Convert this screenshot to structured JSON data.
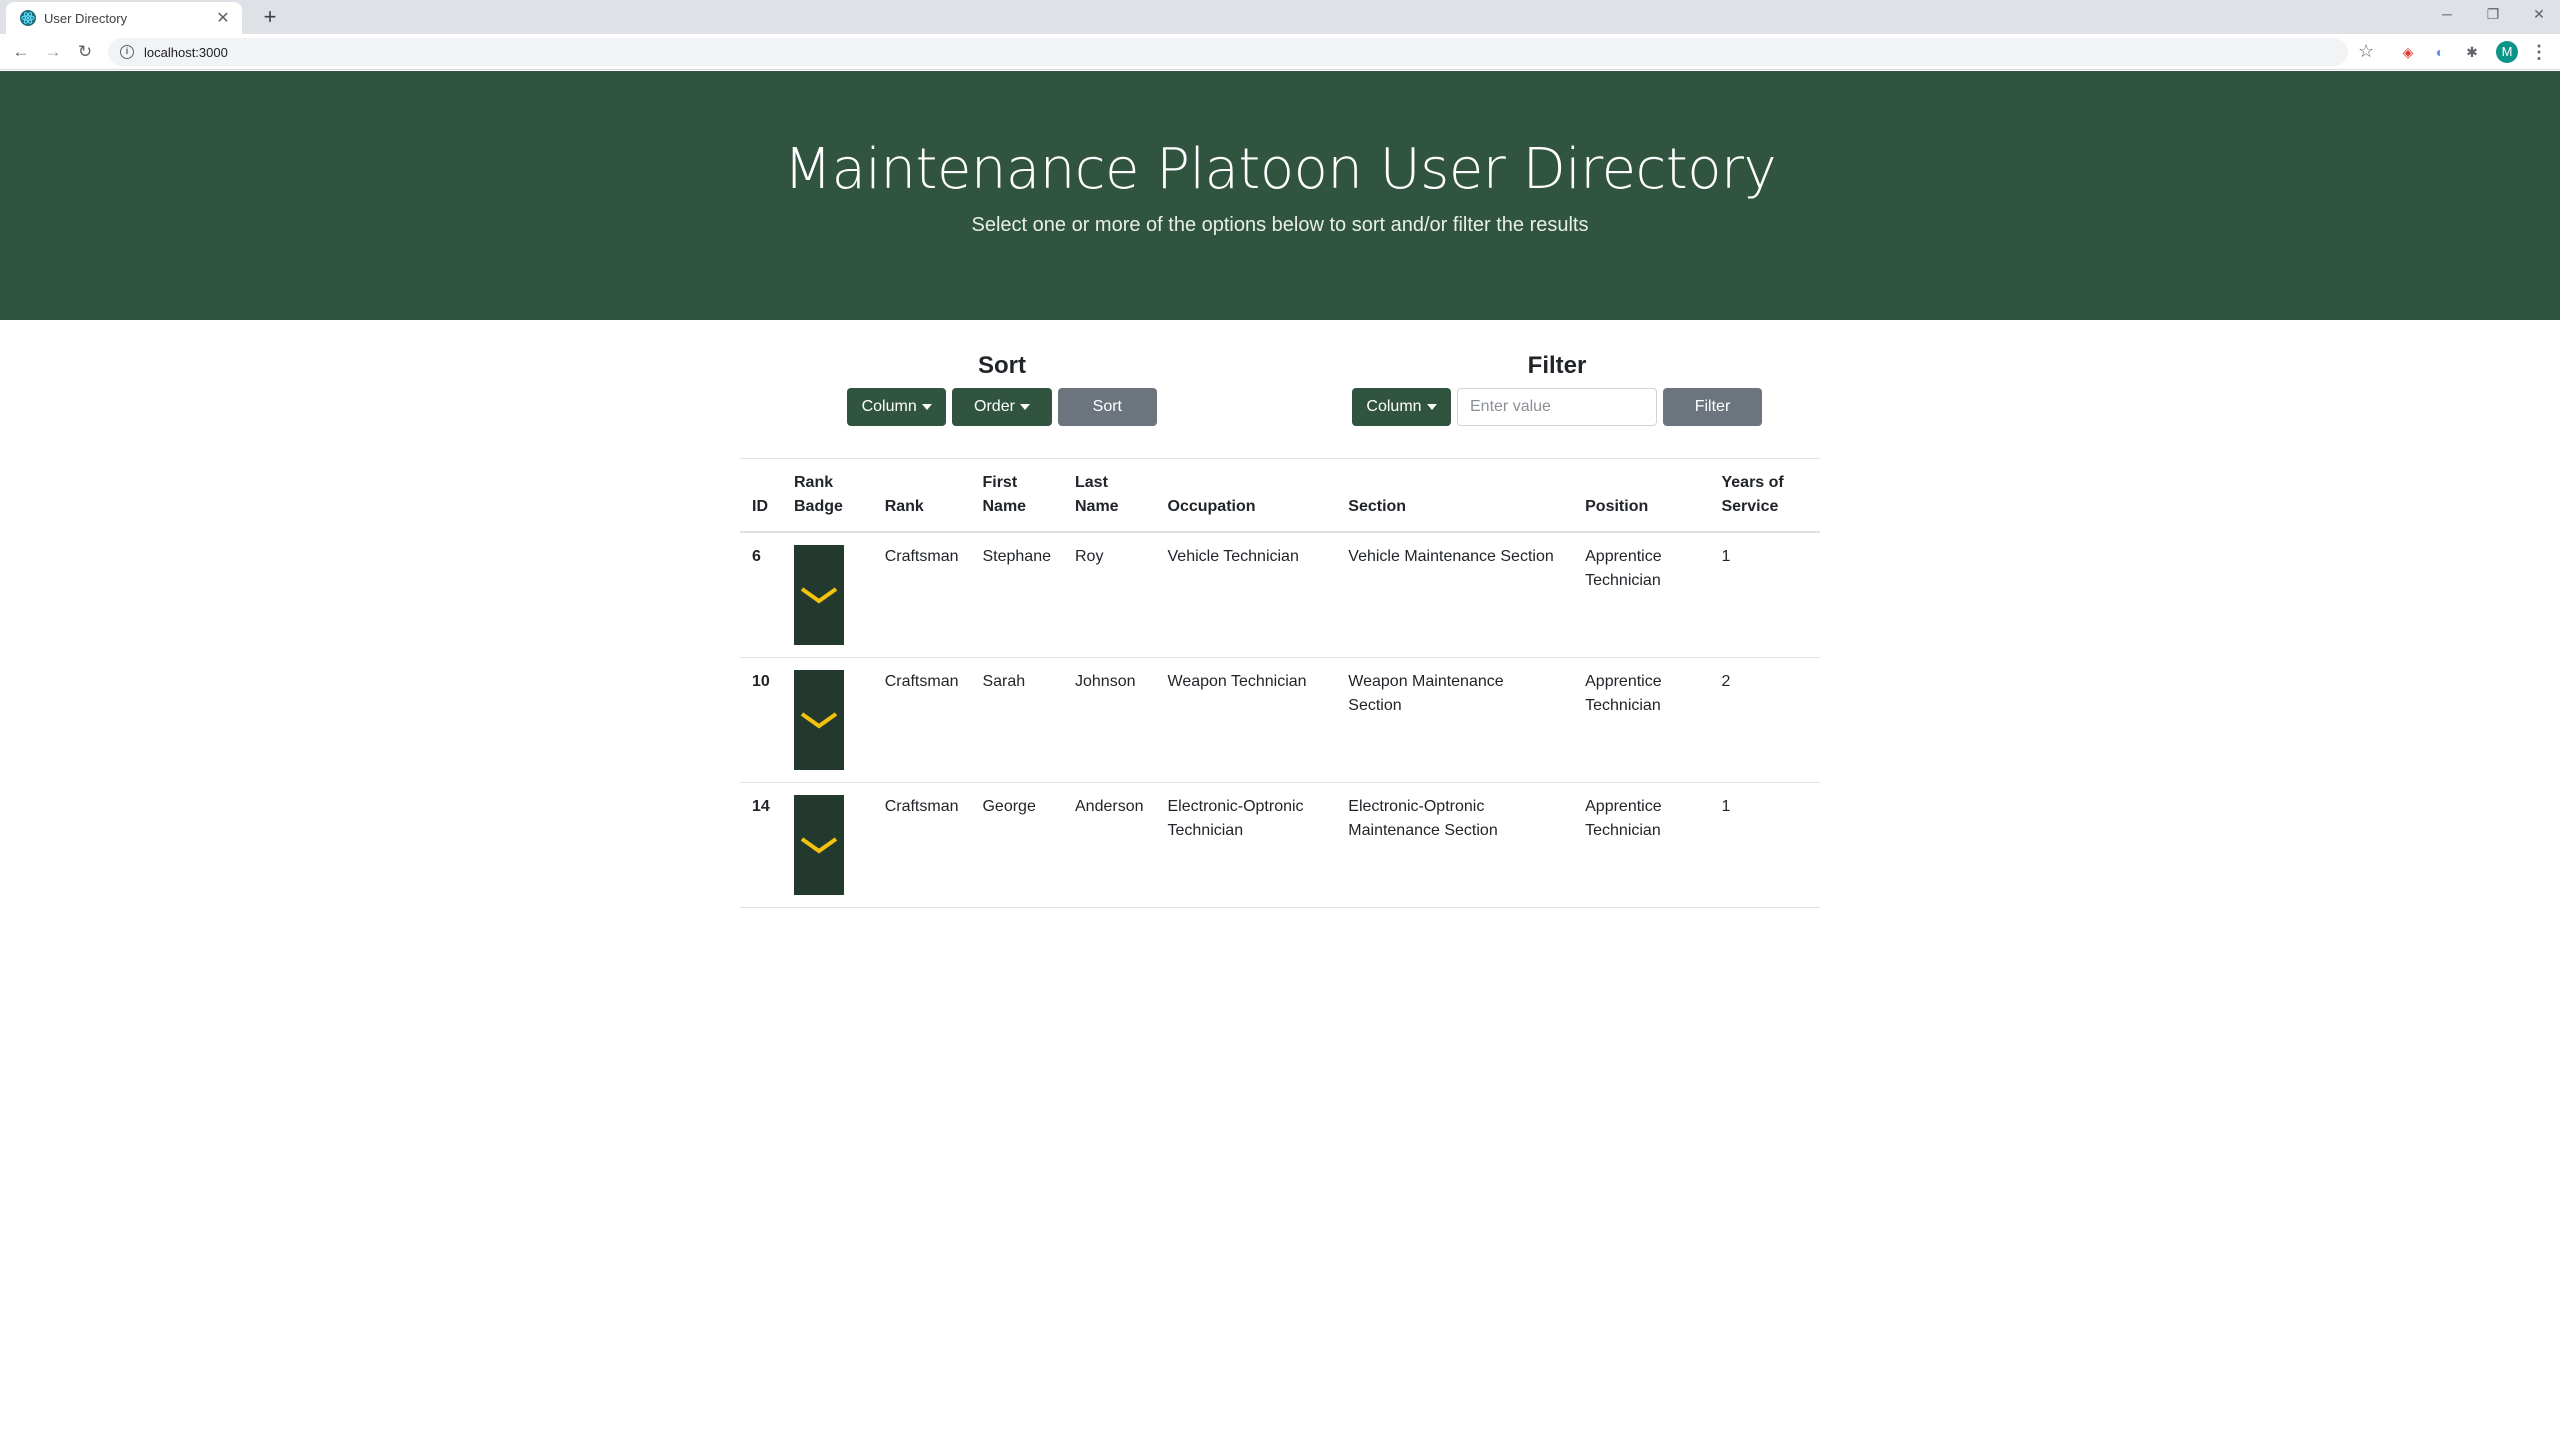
{
  "browser": {
    "tab_title": "User Directory",
    "tab_close": "✕",
    "new_tab": "+",
    "url": "localhost:3000",
    "minimize": "─",
    "restore": "❐",
    "close": "✕",
    "avatar_letter": "M"
  },
  "hero": {
    "title": "Maintenance Platoon User Directory",
    "subtitle": "Select one or more of the options below to sort and/or filter the results"
  },
  "sort": {
    "heading": "Sort",
    "column_label": "Column",
    "order_label": "Order",
    "button_label": "Sort"
  },
  "filter": {
    "heading": "Filter",
    "column_label": "Column",
    "placeholder": "Enter value",
    "button_label": "Filter"
  },
  "table": {
    "headers": {
      "id": "ID",
      "badge_1": "Rank",
      "badge_2": "Badge",
      "rank": "Rank",
      "first_1": "First",
      "first_2": "Name",
      "last_1": "Last",
      "last_2": "Name",
      "occupation": "Occupation",
      "section": "Section",
      "position": "Position",
      "years_1": "Years of",
      "years_2": "Service"
    },
    "rows": [
      {
        "id": "6",
        "rank": "Craftsman",
        "first": "Stephane",
        "last": "Roy",
        "occupation": "Vehicle Technician",
        "section": "Vehicle Maintenance Section",
        "position": "Apprentice Technician",
        "years": "1"
      },
      {
        "id": "10",
        "rank": "Craftsman",
        "first": "Sarah",
        "last": "Johnson",
        "occupation": "Weapon Technician",
        "section": "Weapon Maintenance Section",
        "position": "Apprentice Technician",
        "years": "2"
      },
      {
        "id": "14",
        "rank": "Craftsman",
        "first": "George",
        "last": "Anderson",
        "occupation": "Electronic-Optronic Technician",
        "section": "Electronic-Optronic Maintenance Section",
        "position": "Apprentice Technician",
        "years": "1"
      }
    ]
  },
  "colors": {
    "hero_bg": "#315440",
    "button_dark": "#315440",
    "button_gray": "#6c757d",
    "badge_bg": "#24392d",
    "chevron": "#f2c20f"
  }
}
